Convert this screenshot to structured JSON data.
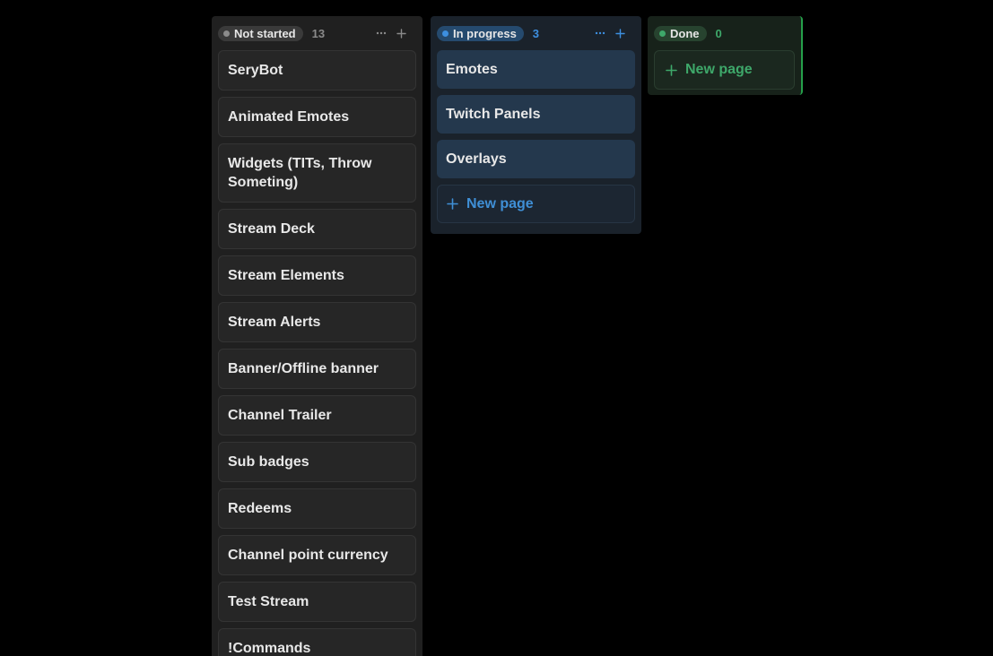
{
  "columns": {
    "not_started": {
      "label": "Not started",
      "count": "13",
      "dot_color": "#8c8c8c",
      "pill_color": "#3a3a3a",
      "cards": [
        "SeryBot",
        "Animated Emotes",
        "Widgets (TITs, Throw Someting)",
        "Stream Deck",
        "Stream Elements",
        "Stream Alerts",
        "Banner/Offline banner",
        "Channel Trailer",
        "Sub badges",
        "Redeems",
        "Channel point currency",
        "Test Stream",
        "!Commands"
      ]
    },
    "in_progress": {
      "label": "In progress",
      "count": "3",
      "dot_color": "#3d8fe0",
      "pill_color": "#254a6e",
      "cards": [
        "Emotes",
        "Twitch Panels",
        "Overlays"
      ],
      "new_page_label": "New page"
    },
    "done": {
      "label": "Done",
      "count": "0",
      "dot_color": "#3ea86a",
      "pill_color": "#27432f",
      "new_page_label": "New page"
    }
  },
  "icons": {
    "more": "more-horizontal-icon",
    "add": "plus-icon"
  }
}
